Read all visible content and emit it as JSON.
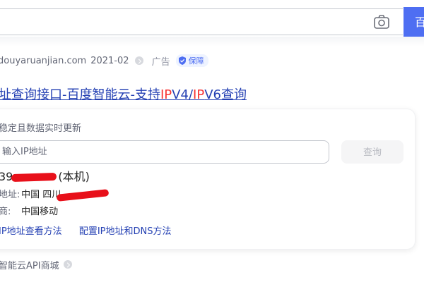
{
  "search": {
    "query": "",
    "button_label": "百度一下"
  },
  "result": {
    "meta": {
      "site": "douyaruanjian.com",
      "date": "2021-02",
      "ad_label": "广告",
      "badge": "保障"
    },
    "title_parts": [
      "址查询接口-百度智能云-支持",
      "IP",
      "V4/",
      "IP",
      "V6查询"
    ],
    "description": "稳定且数据实时更新",
    "ip_input_placeholder": "输入IP地址",
    "query_button": "查询",
    "ip_prefix": "39",
    "ip_suffix": "(本机)",
    "location_label": "地址:",
    "location_value": "中国 四川",
    "isp_label": "商:",
    "isp_value": "中国移动",
    "links": [
      "IP地址查看方法",
      "配置IP地址和DNS方法"
    ],
    "source": "智能云API商城"
  },
  "colors": {
    "link": "#2440b3",
    "highlight": "#f73131",
    "brand": "#4e6ef2",
    "redaction": "#e8101a"
  }
}
